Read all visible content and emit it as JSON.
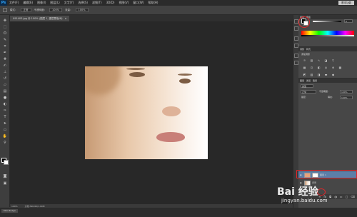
{
  "app": {
    "logo": "Ps",
    "workspace": "基本功能"
  },
  "menu": [
    "文件(F)",
    "编辑(E)",
    "图像(I)",
    "图层(L)",
    "文字(Y)",
    "选择(S)",
    "滤镜(T)",
    "3D(D)",
    "视图(V)",
    "窗口(W)",
    "帮助(H)"
  ],
  "options": {
    "mode_label": "模式：",
    "mode_value": "正常",
    "opacity_label": "不透明度：",
    "opacity_value": "100%",
    "flow_label": "流量：",
    "flow_value": "100%"
  },
  "document": {
    "tab": "091403.jpg @ 100% (图层 1, 图层蒙版/8)",
    "close": "×"
  },
  "status": {
    "zoom": "100%",
    "doc": "文档:390.6K/1.00M"
  },
  "bottom": {
    "mini_bridge": "Mini Bridge"
  },
  "panels": {
    "color_tabs": [
      "颜色",
      "色板"
    ],
    "k_value": "0",
    "adjust_tabs": [
      "调整",
      "样式"
    ],
    "adjust_title": "添加调整",
    "layers_tabs": [
      "图层",
      "通道",
      "路径"
    ],
    "kind_label": "类型",
    "blend_mode": "正常",
    "opacity_label": "不透明度:",
    "opacity_value": "100%",
    "lock_label": "锁定:",
    "fill_label": "填充:",
    "fill_value": "100%",
    "layers": [
      {
        "name": "图层 1",
        "selected": true
      },
      {
        "name": "背景",
        "selected": false
      }
    ]
  },
  "watermark": {
    "main": "Bai 经验",
    "sub": "jingyan.baidu.com"
  },
  "colors": {
    "highlight": "#e2262a",
    "selection": "#5c7fa8"
  },
  "icons": [
    "move-icon",
    "marquee-icon",
    "lasso-icon",
    "quick-select-icon",
    "crop-icon",
    "eyedropper-icon",
    "healing-icon",
    "brush-icon",
    "stamp-icon",
    "history-brush-icon",
    "eraser-icon",
    "gradient-icon",
    "blur-icon",
    "dodge-icon",
    "pen-icon",
    "type-icon",
    "path-select-icon",
    "shape-icon",
    "hand-icon",
    "zoom-icon"
  ]
}
